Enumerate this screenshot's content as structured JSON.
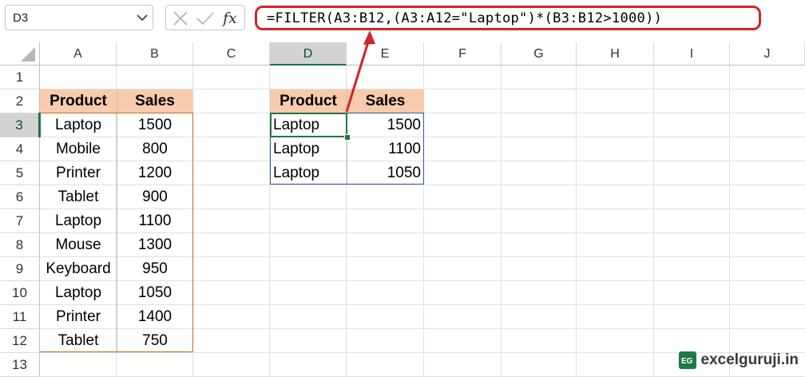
{
  "name_box": "D3",
  "formula": "=FILTER(A3:B12,(A3:A12=\"Laptop\")*(B3:B12>1000))",
  "columns": [
    "A",
    "B",
    "C",
    "D",
    "E",
    "F",
    "G",
    "H",
    "I",
    "J"
  ],
  "rows": [
    "1",
    "2",
    "3",
    "4",
    "5",
    "6",
    "7",
    "8",
    "9",
    "10",
    "11",
    "12",
    "13"
  ],
  "source": {
    "headers": [
      "Product",
      "Sales"
    ],
    "data": [
      [
        "Laptop",
        "1500"
      ],
      [
        "Mobile",
        "800"
      ],
      [
        "Printer",
        "1200"
      ],
      [
        "Tablet",
        "900"
      ],
      [
        "Laptop",
        "1100"
      ],
      [
        "Mouse",
        "1300"
      ],
      [
        "Keyboard",
        "950"
      ],
      [
        "Laptop",
        "1050"
      ],
      [
        "Printer",
        "1400"
      ],
      [
        "Tablet",
        "750"
      ]
    ]
  },
  "result": {
    "headers": [
      "Product",
      "Sales"
    ],
    "data": [
      [
        "Laptop",
        "1500"
      ],
      [
        "Laptop",
        "1100"
      ],
      [
        "Laptop",
        "1050"
      ]
    ]
  },
  "watermark": "excelguruji.in",
  "colors": {
    "header_fill": "#f8cbad",
    "formula_border": "#d0242a",
    "active_cell": "#217346",
    "source_border": "#bf6f2a",
    "result_border": "#2f5e8e"
  }
}
